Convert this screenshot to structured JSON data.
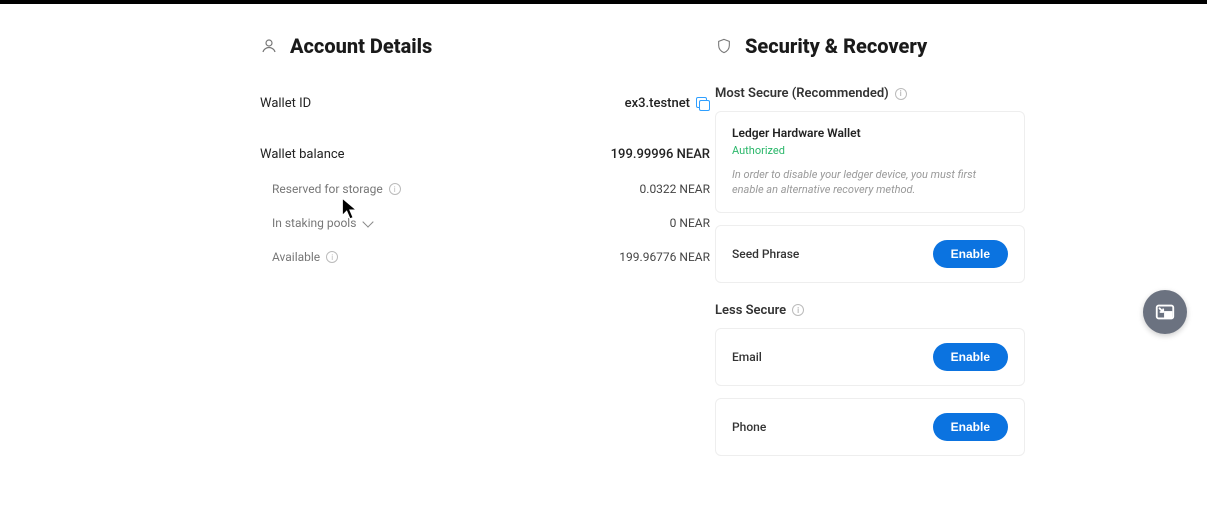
{
  "account": {
    "title": "Account Details",
    "wallet_id_label": "Wallet ID",
    "wallet_id_value": "ex3.testnet",
    "balance_label": "Wallet balance",
    "balance_value": "199.99996 NEAR",
    "reserved_label": "Reserved for storage",
    "reserved_value": "0.0322 NEAR",
    "staking_label": "In staking pools",
    "staking_value": "0 NEAR",
    "available_label": "Available",
    "available_value": "199.96776 NEAR"
  },
  "security": {
    "title": "Security & Recovery",
    "most_secure_label": "Most Secure (Recommended)",
    "ledger": {
      "title": "Ledger Hardware Wallet",
      "status": "Authorized",
      "desc": "In order to disable your ledger device, you must first enable an alternative recovery method."
    },
    "seed_phrase_label": "Seed Phrase",
    "less_secure_label": "Less Secure",
    "email_label": "Email",
    "phone_label": "Phone",
    "enable_label": "Enable"
  }
}
